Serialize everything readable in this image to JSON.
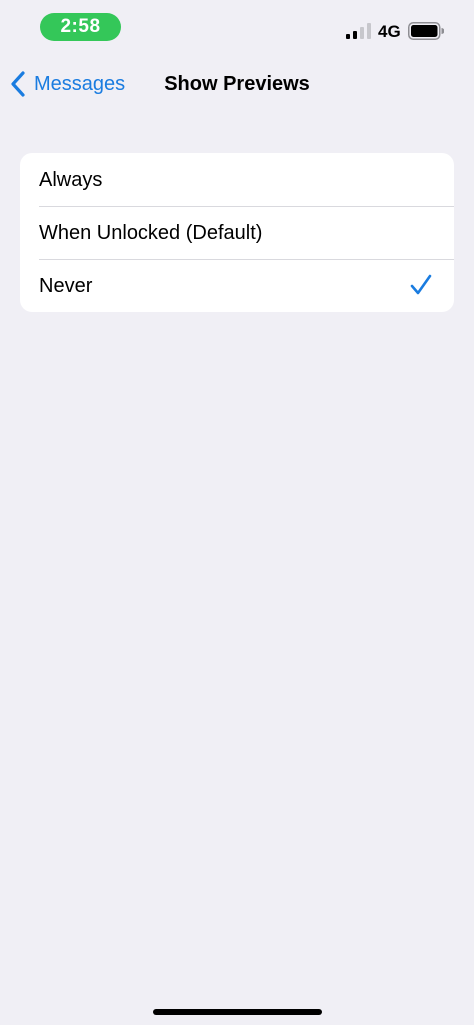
{
  "status_bar": {
    "time": "2:58",
    "network": "4G",
    "signal_icon": "cellular-signal-icon",
    "battery_icon": "battery-icon",
    "time_pill_color": "#34c759"
  },
  "nav": {
    "back_label": "Messages",
    "back_icon": "chevron-left-icon",
    "title": "Show Previews",
    "accent_color": "#1a7ce0"
  },
  "options": [
    {
      "label": "Always",
      "selected": false
    },
    {
      "label": "When Unlocked (Default)",
      "selected": false
    },
    {
      "label": "Never",
      "selected": true
    }
  ],
  "colors": {
    "background": "#f0eff5",
    "card": "#ffffff",
    "checkmark": "#1a7ce0"
  }
}
